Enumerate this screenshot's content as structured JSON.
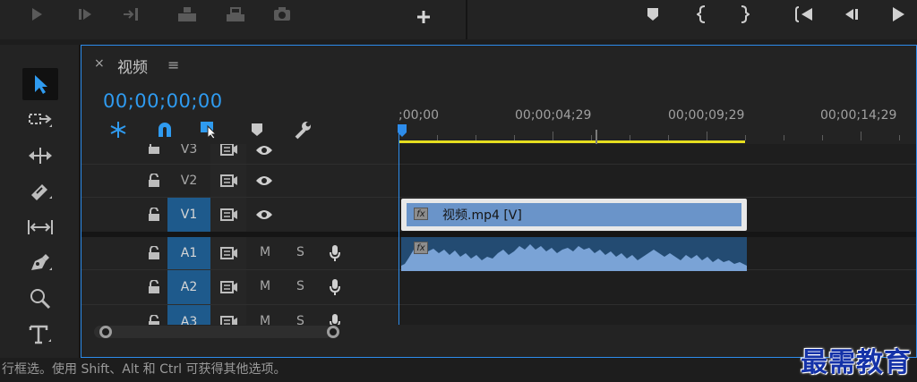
{
  "sequence": {
    "tab_title": "视频",
    "close_glyph": "×",
    "menu_glyph": "≡",
    "timecode": "00;00;00;00"
  },
  "ruler": {
    "labels": [
      ";00;00",
      "00;00;04;29",
      "00;00;09;29",
      "00;00;14;29"
    ]
  },
  "tracks": {
    "video": [
      {
        "label": "V3",
        "targeted": false
      },
      {
        "label": "V2",
        "targeted": false
      },
      {
        "label": "V1",
        "targeted": true
      }
    ],
    "audio": [
      {
        "label": "A1",
        "targeted": true,
        "mute": "M",
        "solo": "S"
      },
      {
        "label": "A2",
        "targeted": true,
        "mute": "M",
        "solo": "S"
      },
      {
        "label": "A3",
        "targeted": true,
        "mute": "M",
        "solo": "S"
      }
    ]
  },
  "clips": {
    "video_clip_name": "视频.mp4 [V]",
    "fx_label": "fx"
  },
  "status": {
    "text": "行框选。使用 Shift、Alt 和 Ctrl 可获得其他选项。"
  },
  "watermark": {
    "text": "最需教育"
  },
  "colors": {
    "accent_blue": "#2f9bf0",
    "panel_border": "#2d8ceb",
    "work_area": "#e6de1f",
    "video_clip": "#6a94c9",
    "audio_clip": "#234b72",
    "track_target": "#1e5a8c"
  },
  "icons": {
    "top_toolbar": [
      "play-icon",
      "step-forward-icon",
      "insert-icon",
      "overwrite-icon",
      "export-frame-icon",
      "camera-icon",
      "add-icon",
      "marker-icon",
      "mark-in-icon",
      "mark-out-icon",
      "go-to-in-icon",
      "step-back-icon",
      "play-right-icon"
    ],
    "tools": [
      "selection-tool-icon",
      "track-select-tool-icon",
      "ripple-edit-tool-icon",
      "razor-tool-icon",
      "slip-tool-icon",
      "pen-tool-icon",
      "zoom-tool-icon",
      "type-tool-icon"
    ]
  }
}
